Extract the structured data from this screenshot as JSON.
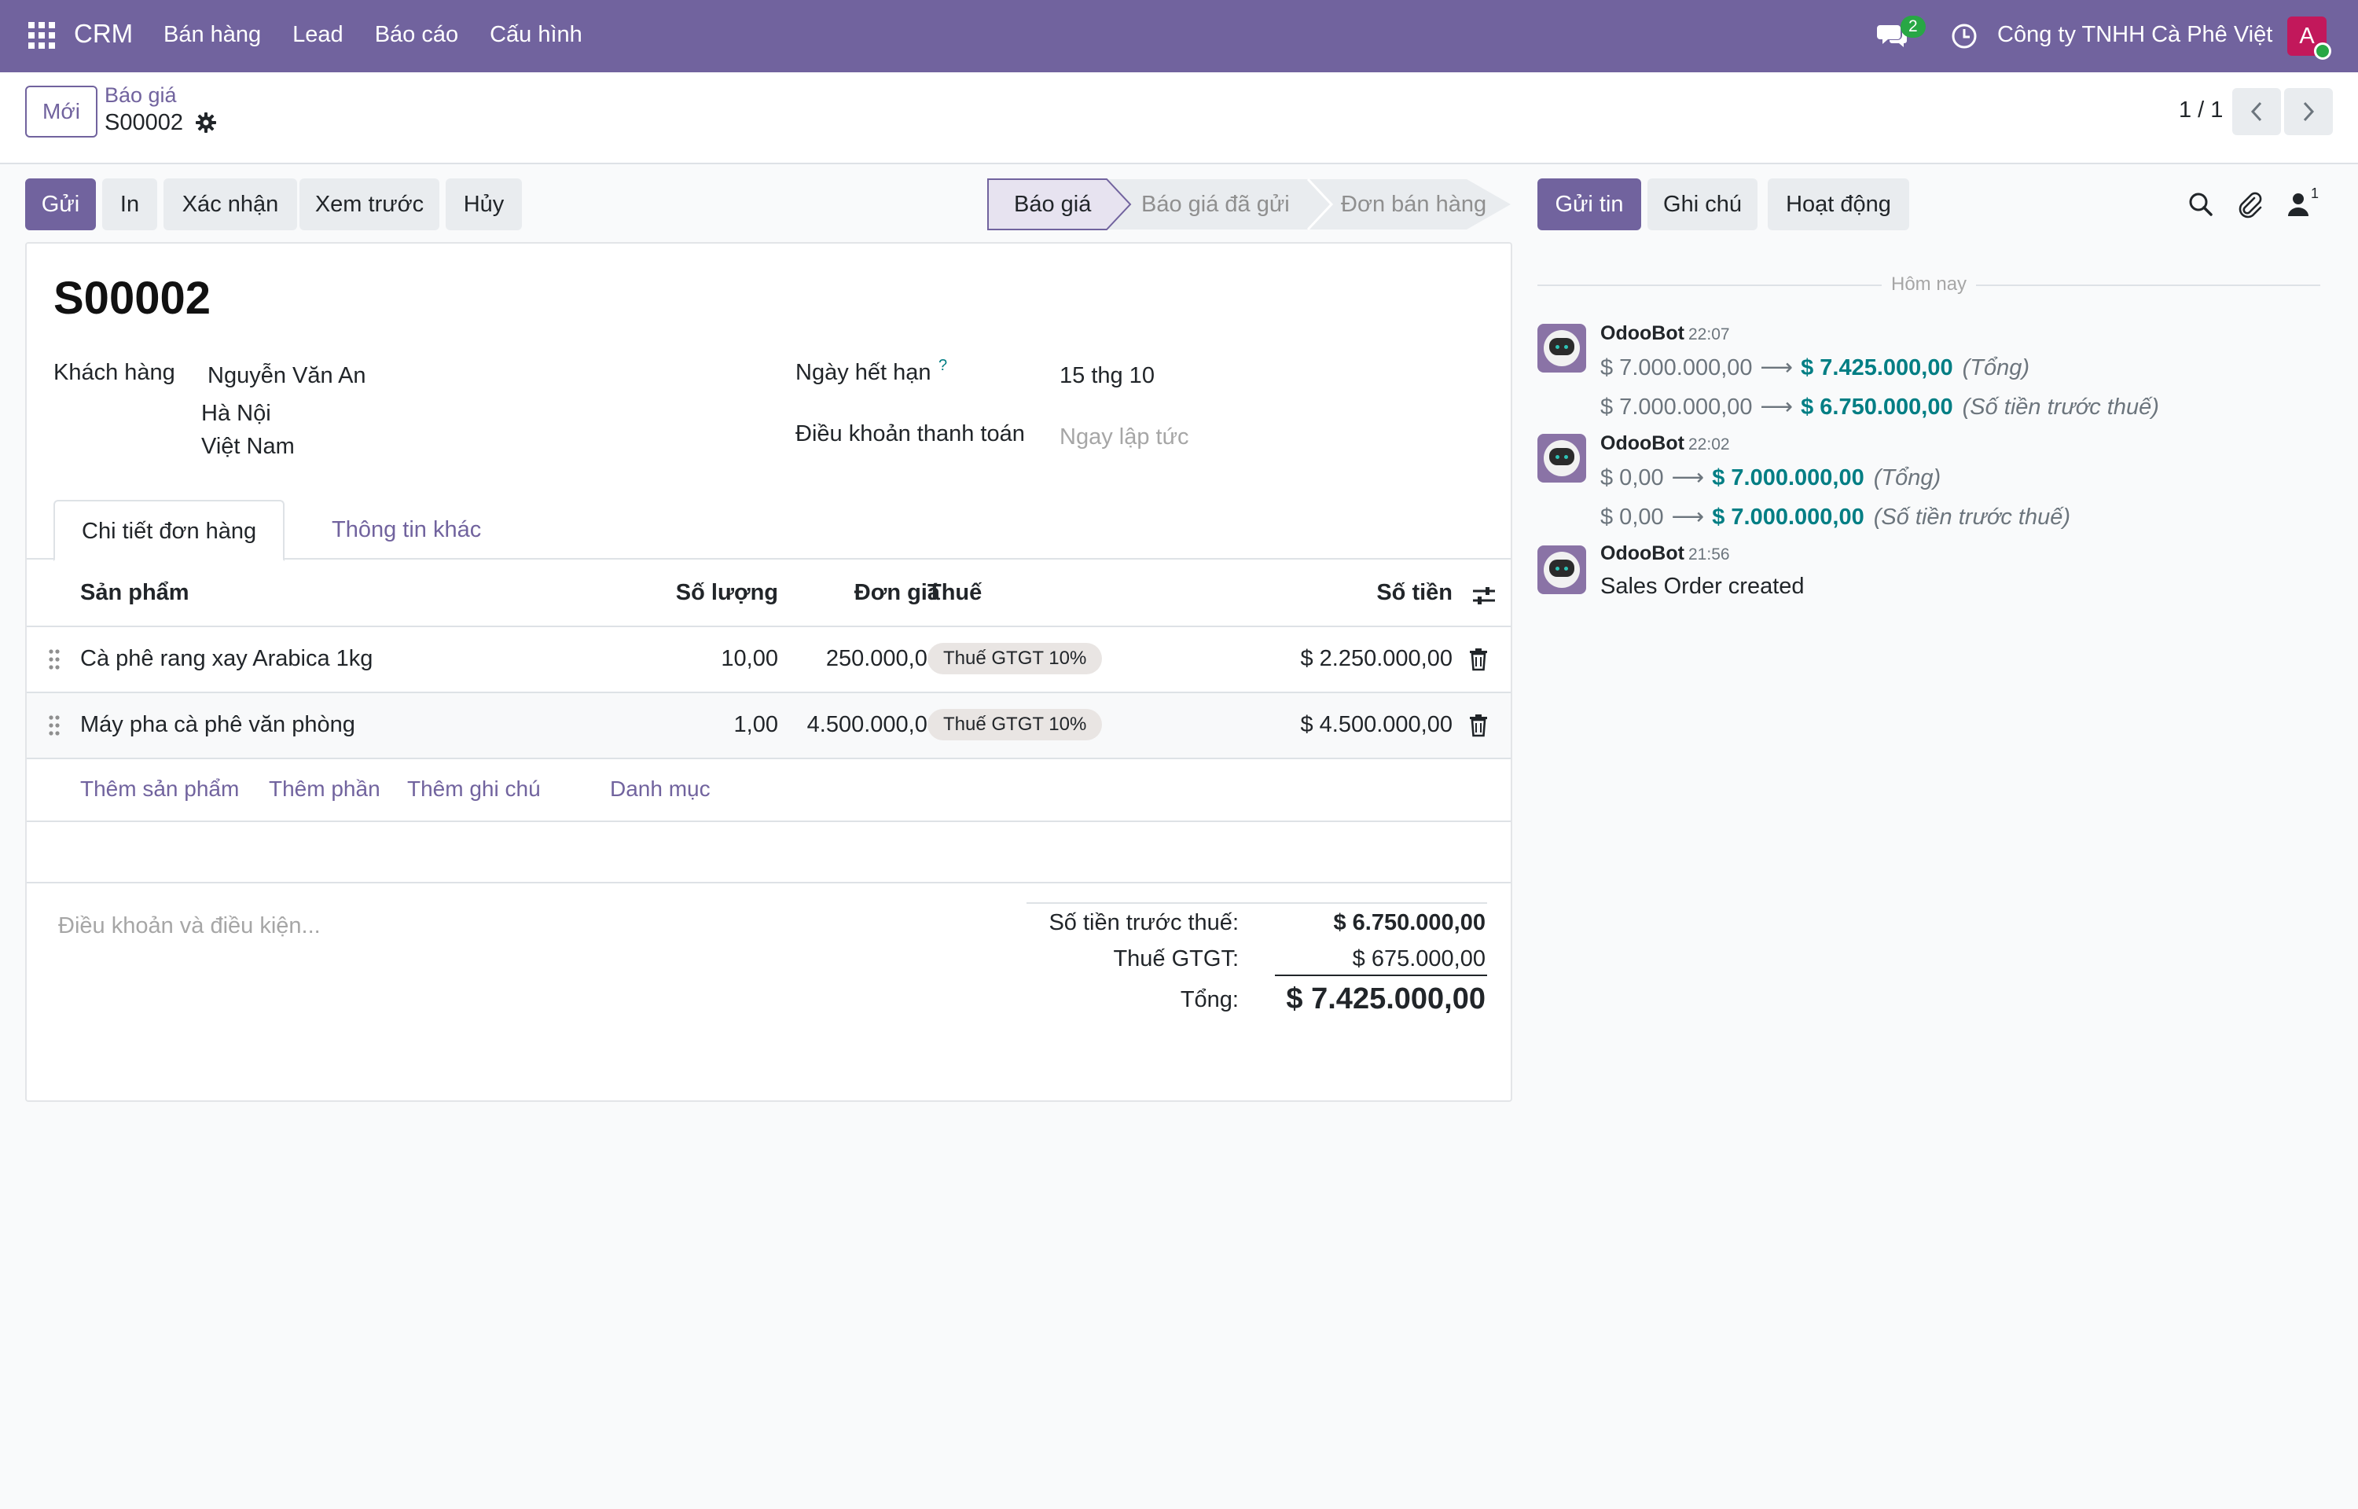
{
  "navbar": {
    "brand": "CRM",
    "menu": [
      "Bán hàng",
      "Lead",
      "Báo cáo",
      "Cấu hình"
    ],
    "chat_count": "2",
    "company": "Công ty TNHH Cà Phê Việt",
    "avatar_letter": "A",
    "accent": "#71639e"
  },
  "control_panel": {
    "new_label": "Mới",
    "breadcrumb_parent": "Báo giá",
    "breadcrumb_current": "S00002",
    "pager": "1 / 1"
  },
  "actions": {
    "send": "Gửi",
    "print": "In",
    "confirm": "Xác nhận",
    "preview": "Xem trước",
    "cancel": "Hủy"
  },
  "statusbar": {
    "stages": [
      "Báo giá",
      "Báo giá đã gửi",
      "Đơn bán hàng"
    ],
    "active": "Báo giá"
  },
  "form": {
    "title": "S00002",
    "customer_label": "Khách hàng",
    "customer_name": "Nguyễn Văn An",
    "customer_city": "Hà Nội",
    "customer_country": "Việt Nam",
    "expiry_label": "Ngày hết hạn",
    "expiry_help": "?",
    "expiry_value": "15 thg 10",
    "payment_terms_label": "Điều khoản thanh toán",
    "payment_terms_placeholder": "Ngay lập tức"
  },
  "tabs": [
    "Chi tiết đơn hàng",
    "Thông tin khác"
  ],
  "order_lines": {
    "headers": {
      "product": "Sản phẩm",
      "qty": "Số lượng",
      "price": "Đơn giá",
      "tax": "Thuế",
      "amount": "Số tiền"
    },
    "rows": [
      {
        "product": "Cà phê rang xay Arabica 1kg",
        "qty": "10,00",
        "price": "250.000,00",
        "tax": "Thuế GTGT 10%",
        "amount": "$ 2.250.000,00"
      },
      {
        "product": "Máy pha cà phê văn phòng",
        "qty": "1,00",
        "price": "4.500.000,00",
        "tax": "Thuế GTGT 10%",
        "amount": "$ 4.500.000,00"
      }
    ],
    "add_links": [
      "Thêm sản phẩm",
      "Thêm phần",
      "Thêm ghi chú",
      "Danh mục"
    ]
  },
  "footer": {
    "terms_placeholder": "Điều khoản và điều kiện...",
    "untaxed_label": "Số tiền trước thuế:",
    "untaxed_value": "$ 6.750.000,00",
    "tax_label": "Thuế GTGT:",
    "tax_value": "$ 675.000,00",
    "total_label": "Tổng:",
    "total_value": "$ 7.425.000,00"
  },
  "chatter": {
    "send_message": "Gửi tin",
    "log_note": "Ghi chú",
    "activities": "Hoạt động",
    "followers_count": "1",
    "today": "Hôm nay",
    "messages": [
      {
        "author": "OdooBot",
        "time": "22:07",
        "changes": [
          {
            "old": "$ 7.000.000,00",
            "new": "$ 7.425.000,00",
            "field": "(Tổng)"
          },
          {
            "old": "$ 7.000.000,00",
            "new": "$ 6.750.000,00",
            "field": "(Số tiền trước thuế)"
          }
        ]
      },
      {
        "author": "OdooBot",
        "time": "22:02",
        "changes": [
          {
            "old": "$ 0,00",
            "new": "$ 7.000.000,00",
            "field": "(Tổng)"
          },
          {
            "old": "$ 0,00",
            "new": "$ 7.000.000,00",
            "field": "(Số tiền trước thuế)"
          }
        ]
      },
      {
        "author": "OdooBot",
        "time": "21:56",
        "body": "Sales Order created"
      }
    ]
  }
}
